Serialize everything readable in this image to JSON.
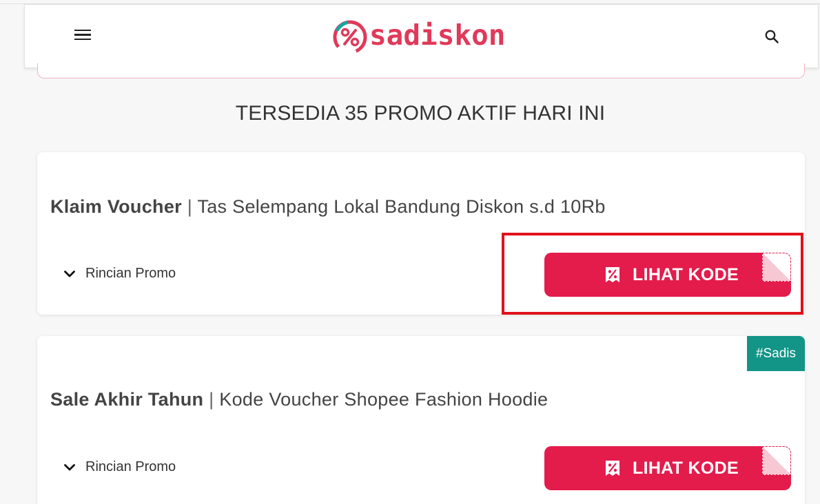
{
  "header": {
    "logo_text": "sadiskon",
    "menu_icon": "hamburger-menu-icon",
    "search_icon": "search-icon",
    "brand_color": "#e0395a"
  },
  "main": {
    "heading": "TERSEDIA 35 PROMO AKTIF HARI INI"
  },
  "promos": [
    {
      "title_strong": "Klaim Voucher",
      "separator": "|",
      "title_rest": "Tas Selempang Lokal Bandung Diskon s.d 10Rb",
      "details_label": "Rincian Promo",
      "button_label": "LIHAT KODE",
      "badge": ""
    },
    {
      "title_strong": "Sale Akhir Tahun",
      "separator": "|",
      "title_rest": "Kode Voucher Shopee Fashion Hoodie",
      "details_label": "Rincian Promo",
      "button_label": "LIHAT KODE",
      "badge": "#Sadis"
    }
  ],
  "colors": {
    "button": "#e31c4c",
    "badge": "#129486",
    "highlight": "#e0121c"
  }
}
